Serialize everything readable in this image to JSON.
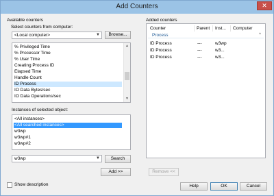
{
  "window": {
    "title": "Add Counters",
    "close_symbol": "✕"
  },
  "left": {
    "available_label": "Available counters",
    "select_from_label": "Select counters from computer:",
    "computer_value": "<Local computer>",
    "browse_label": "Browse...",
    "counters": [
      "% Privileged Time",
      "% Processor Time",
      "% User Time",
      "Creating Process ID",
      "Elapsed Time",
      "Handle Count",
      "ID Process",
      "IO Data Bytes/sec",
      "IO Data Operations/sec"
    ],
    "selected_counter": "ID Process",
    "instances_label": "Instances of selected object:",
    "instances": [
      "<All instances>",
      "<All searched instances>",
      "w3wp",
      "w3wp#1",
      "w3wp#2"
    ],
    "highlighted_instance": "<All searched instances>",
    "search_value": "w3wp",
    "search_label": "Search",
    "add_label": "Add >>"
  },
  "right": {
    "added_label": "Added counters",
    "columns": [
      "Counter",
      "Parent",
      "Inst...",
      "Computer"
    ],
    "group": "Process",
    "rows": [
      {
        "counter": "ID Process",
        "parent": "---",
        "instance": "w3wp"
      },
      {
        "counter": "ID Process",
        "parent": "---",
        "instance": "w3..."
      },
      {
        "counter": "ID Process",
        "parent": "---",
        "instance": "w3..."
      }
    ],
    "remove_label": "Remove <<"
  },
  "footer": {
    "show_description_label": "Show description",
    "help_label": "Help",
    "ok_label": "OK",
    "cancel_label": "Cancel"
  }
}
